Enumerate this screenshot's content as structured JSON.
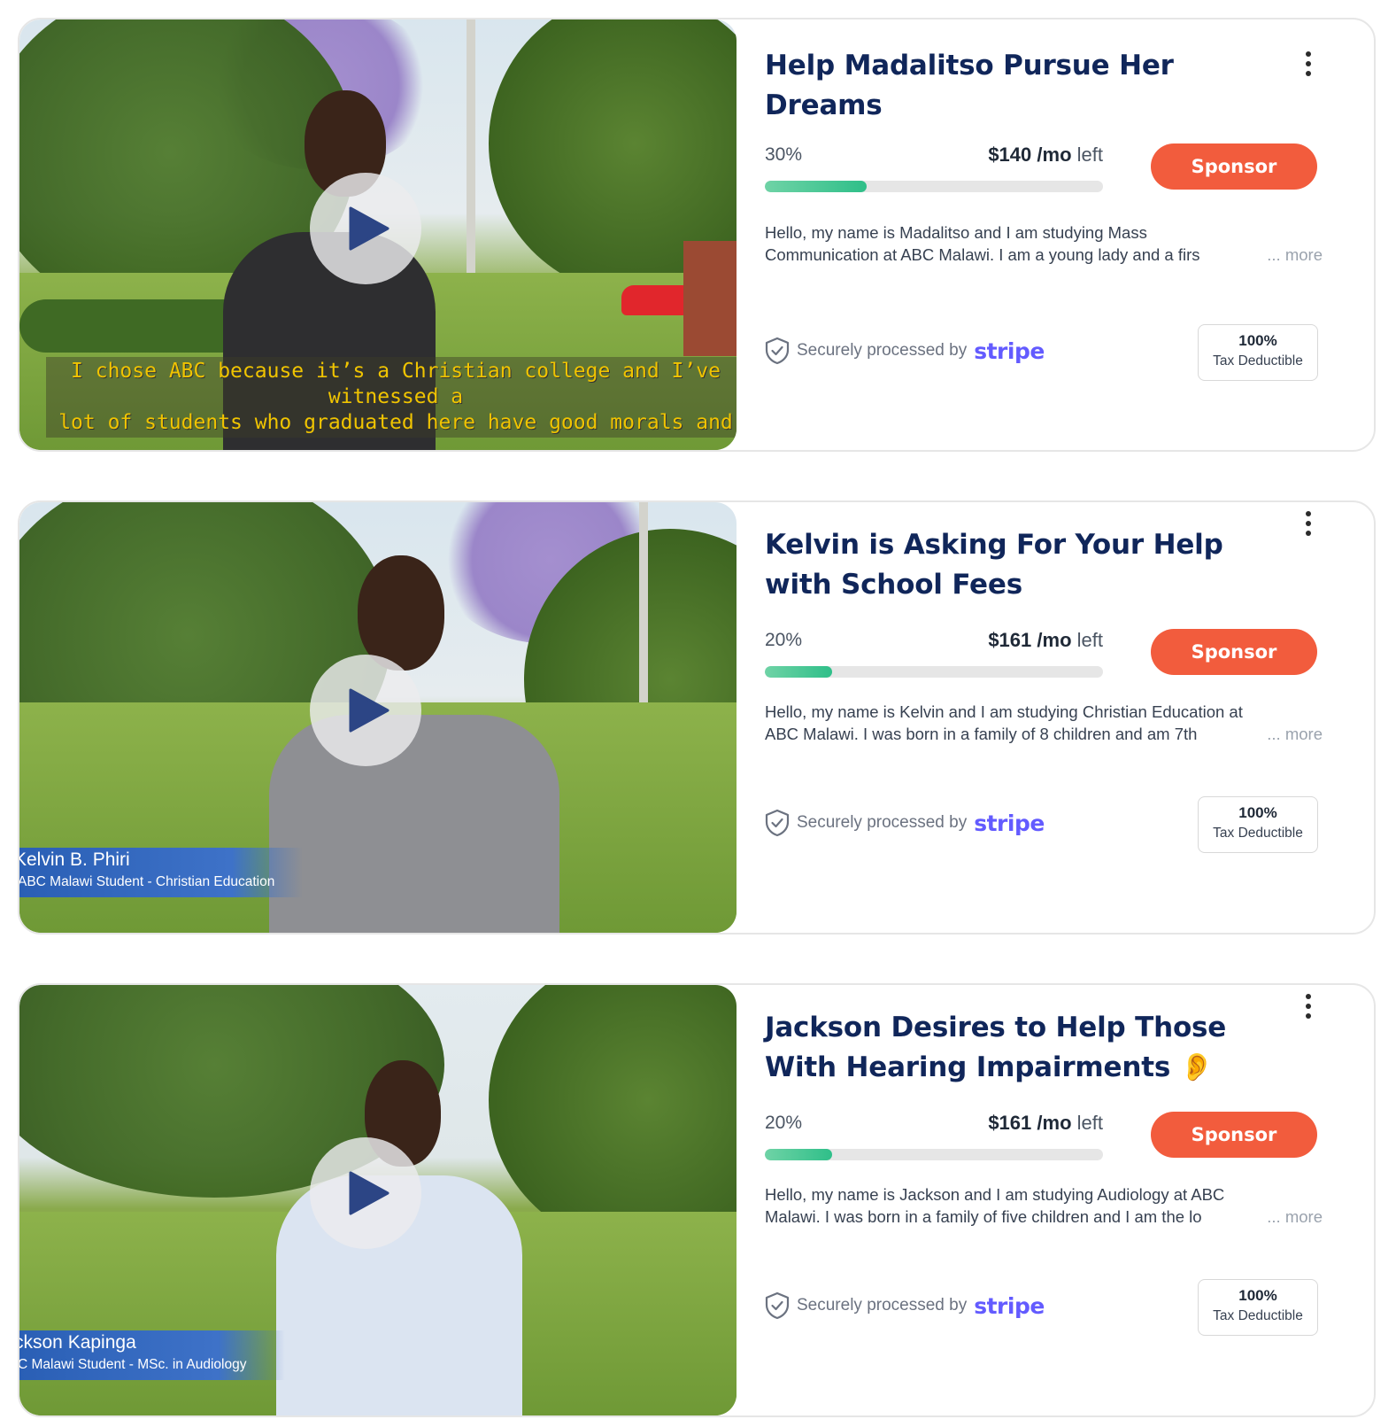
{
  "cards": [
    {
      "title": "Help Madalitso Pursue Her Dreams",
      "progress_percent_label": "30%",
      "progress_fraction": 0.3,
      "amount": "$140",
      "per": "/mo",
      "left_label": "left",
      "sponsor_label": "Sponsor",
      "description_line1": "Hello, my name is Madalitso and I am studying Mass",
      "description_line2": "Communication at ABC Malawi. I am a young lady and a firs",
      "more_label": "... more",
      "secure_text": "Securely processed by",
      "stripe_label": "stripe",
      "tax_line1": "100%",
      "tax_line2": "Tax Deductible",
      "video_caption_line1": "I chose ABC because it’s a Christian college and I’ve witnessed a",
      "video_caption_line2": "lot of students who graduated here have good morals and"
    },
    {
      "title": "Kelvin is Asking For Your Help with School Fees",
      "progress_percent_label": "20%",
      "progress_fraction": 0.2,
      "amount": "$161",
      "per": "/mo",
      "left_label": "left",
      "sponsor_label": "Sponsor",
      "description_line1": "Hello, my name is Kelvin and I am studying Christian Education at",
      "description_line2": "ABC Malawi. I was born in a family of 8 children and am 7th",
      "more_label": "... more",
      "secure_text": "Securely processed by",
      "stripe_label": "stripe",
      "tax_line1": "100%",
      "tax_line2": "Tax Deductible",
      "video_name": "Kelvin B. Phiri",
      "video_subtitle": "ABC Malawi Student - Christian Education"
    },
    {
      "title": "Jackson Desires to Help Those With Hearing Impairments 👂",
      "progress_percent_label": "20%",
      "progress_fraction": 0.2,
      "amount": "$161",
      "per": "/mo",
      "left_label": "left",
      "sponsor_label": "Sponsor",
      "description_line1": "Hello, my name is Jackson and I am studying Audiology at ABC",
      "description_line2": "Malawi. I was born in a family of five children and I am the lo",
      "more_label": "... more",
      "secure_text": "Securely processed by",
      "stripe_label": "stripe",
      "tax_line1": "100%",
      "tax_line2": "Tax Deductible",
      "video_name": "ckson Kapinga",
      "video_subtitle": "C Malawi Student - MSc. in Audiology"
    }
  ],
  "colors": {
    "title": "#10265a",
    "sponsor_button": "#f25c3d",
    "progress_fill": "#2fbf89",
    "progress_track": "#e6e6e6",
    "stripe_brand": "#635bff",
    "play_icon": "#2c4585"
  },
  "icons": {
    "play": "play-icon",
    "menu": "kebab-menu-icon",
    "shield": "shield-check-icon"
  }
}
